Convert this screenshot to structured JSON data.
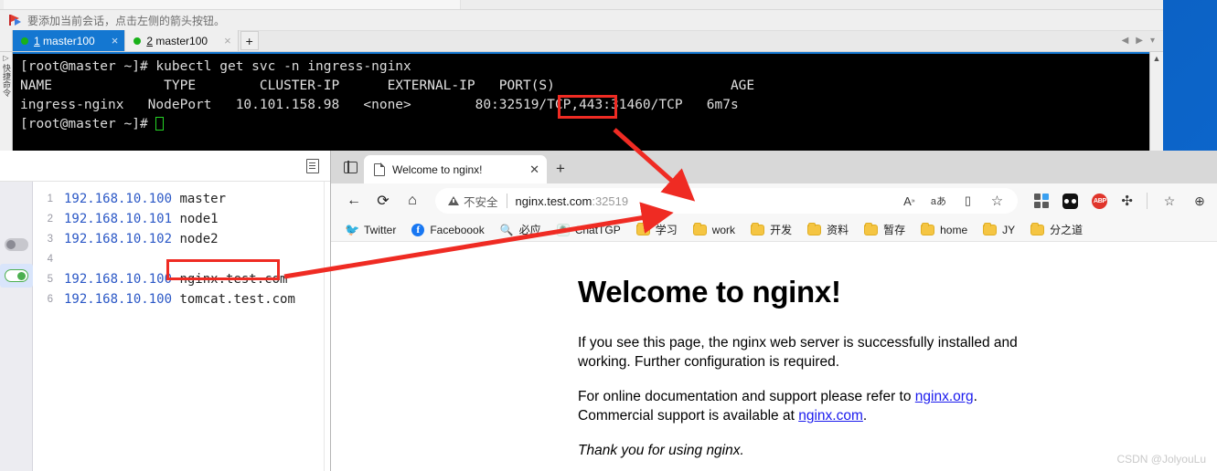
{
  "terminal": {
    "notify_text": "要添加当前会话，点击左侧的箭头按钮。",
    "sidebar_vertical_text": "快捷命令",
    "tabs": [
      {
        "index": "1",
        "label": "master100",
        "active": true,
        "status": "connected"
      },
      {
        "index": "2",
        "label": "master100",
        "active": false,
        "status": "connected"
      }
    ],
    "new_tab_label": "+",
    "lines": {
      "command_prompt": "[root@master ~]# ",
      "command": "kubectl get svc -n ingress-nginx",
      "header": "NAME              TYPE        CLUSTER-IP      EXTERNAL-IP   PORT(S)                      AGE",
      "row": "ingress-nginx   NodePort   10.101.158.98   <none>        80:32519/TCP,443:31460/TCP   6m7s",
      "prompt2": "[root@master ~]# "
    },
    "columns": [
      "NAME",
      "TYPE",
      "CLUSTER-IP",
      "EXTERNAL-IP",
      "PORT(S)",
      "AGE"
    ],
    "service": {
      "name": "ingress-nginx",
      "type": "NodePort",
      "cluster_ip": "10.101.158.98",
      "external_ip": "<none>",
      "ports": "80:32519/TCP,443:31460/TCP",
      "age": "6m7s",
      "highlighted_port": "32519"
    }
  },
  "hosts_editor": {
    "toggles": [
      {
        "name": "system-hosts-toggle",
        "state": "off"
      },
      {
        "name": "custom-hosts-toggle",
        "state": "on"
      }
    ],
    "copy_icon": "document-icon",
    "lines": [
      {
        "num": "1",
        "ip": "192.168.10.100",
        "host": "master"
      },
      {
        "num": "2",
        "ip": "192.168.10.101",
        "host": "node1"
      },
      {
        "num": "3",
        "ip": "192.168.10.102",
        "host": "node2"
      },
      {
        "num": "4",
        "ip": "",
        "host": ""
      },
      {
        "num": "5",
        "ip": "192.168.10.100",
        "host": "nginx.test.com"
      },
      {
        "num": "6",
        "ip": "192.168.10.100",
        "host": "tomcat.test.com"
      }
    ],
    "highlighted_host": "nginx.test.com"
  },
  "browser": {
    "tab": {
      "title": "Welcome to nginx!",
      "close_label": "✕"
    },
    "new_tab_label": "+",
    "nav": {
      "back": "←",
      "reload": "⟳",
      "home": "⌂"
    },
    "address": {
      "security_label": "不安全",
      "url_host": "nginx.test.com",
      "url_port": ":32519"
    },
    "omni_icons": [
      {
        "name": "read-aloud-icon",
        "glyph": "A"
      },
      {
        "name": "translate-icon",
        "glyph": "aあ"
      },
      {
        "name": "split-screen-icon",
        "glyph": "▯"
      },
      {
        "name": "favorite-star-icon",
        "glyph": "☆"
      }
    ],
    "toolbar_icons": [
      {
        "name": "extensions-grid-icon",
        "label": ""
      },
      {
        "name": "dark-reader-icon",
        "label": ""
      },
      {
        "name": "adblock-plus-icon",
        "label": "ABP"
      },
      {
        "name": "puzzle-extension-icon",
        "label": "✥"
      },
      {
        "name": "collections-icon",
        "label": "☆≡"
      },
      {
        "name": "add-tab-to-collection-icon",
        "label": "⊕"
      }
    ],
    "bookmarks": [
      {
        "label": "Twitter",
        "icon": "twitter-icon"
      },
      {
        "label": "Faceboook",
        "icon": "facebook-icon"
      },
      {
        "label": "必应",
        "icon": "bing-search-icon"
      },
      {
        "label": "ChatTGP",
        "icon": "chatgpt-icon"
      },
      {
        "label": "学习",
        "icon": "folder-icon"
      },
      {
        "label": "work",
        "icon": "folder-icon"
      },
      {
        "label": "开发",
        "icon": "folder-icon"
      },
      {
        "label": "资料",
        "icon": "folder-icon"
      },
      {
        "label": "暂存",
        "icon": "folder-icon"
      },
      {
        "label": "home",
        "icon": "folder-icon"
      },
      {
        "label": "JY",
        "icon": "folder-icon"
      },
      {
        "label": "分之道",
        "icon": "folder-icon"
      }
    ]
  },
  "nginx_page": {
    "heading": "Welcome to nginx!",
    "para1": "If you see this page, the nginx web server is successfully installed and working. Further configuration is required.",
    "para2_pre": "For online documentation and support please refer to ",
    "para2_link": "nginx.org",
    "para2_mid": ". Commercial support is available at ",
    "para2_link2": "nginx.com",
    "para2_post": ".",
    "thanks": "Thank you for using nginx."
  },
  "watermark": "CSDN @JolyouLu",
  "colors": {
    "accent_red": "#ef2b23",
    "tab_active_blue": "#1477d1",
    "desktop_blue": "#0d66cf",
    "link_blue": "#1a1aee"
  }
}
